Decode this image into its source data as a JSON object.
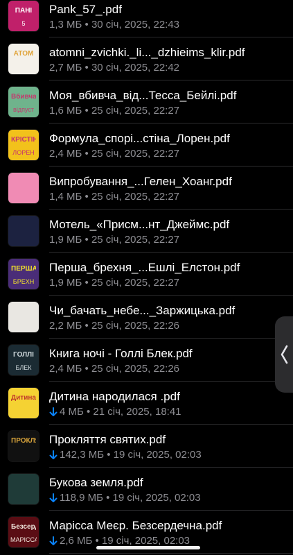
{
  "files": [
    {
      "title": "Pank_57_.pdf",
      "meta": "1,3 МБ • 30 січ, 2025, 22:43",
      "downloading": false,
      "thumb": {
        "bg": "#c0206a",
        "fg": "#fff",
        "t1": "ПАНІ",
        "t2": "5"
      }
    },
    {
      "title": "atomni_zvichki._li..._dzhieims_klir.pdf",
      "meta": "2,7 МБ • 30 січ, 2025, 22:42",
      "downloading": false,
      "thumb": {
        "bg": "#f4f1ea",
        "fg": "#e0a43a",
        "t1": "АТОМ",
        "t2": ""
      }
    },
    {
      "title": "Моя_вбивча_від...Тесса_Бейлі.pdf",
      "meta": "1,6 МБ • 25 січ, 2025, 22:27",
      "downloading": false,
      "thumb": {
        "bg": "#6fb38c",
        "fg": "#c23a6e",
        "t1": "Вбивча",
        "t2": "відпуст"
      }
    },
    {
      "title": "Формула_спорі...стіна_Лорен.pdf",
      "meta": "2,4 МБ • 25 січ, 2025, 22:27",
      "downloading": false,
      "thumb": {
        "bg": "#f2c21b",
        "fg": "#c8356c",
        "t1": "КРІСТІН",
        "t2": "ЛОРЕН"
      }
    },
    {
      "title": "Випробування_...Гелен_Хоанг.pdf",
      "meta": "1,4 МБ • 25 січ, 2025, 22:27",
      "downloading": false,
      "thumb": {
        "bg": "#f08bb4",
        "fg": "#fff",
        "t1": "",
        "t2": ""
      }
    },
    {
      "title": "Мотель_«Присм...нт_Джеймс.pdf",
      "meta": "1,9 МБ • 25 січ, 2025, 22:27",
      "downloading": false,
      "thumb": {
        "bg": "#1c2240",
        "fg": "#f2b64c",
        "t1": "",
        "t2": ""
      }
    },
    {
      "title": "Перша_брехня_...Ешлі_Елстон.pdf",
      "meta": "1,9 МБ • 25 січ, 2025, 22:27",
      "downloading": false,
      "thumb": {
        "bg": "#4a2d78",
        "fg": "#f2e22c",
        "t1": "ПЕРША",
        "t2": "БРЕХН"
      }
    },
    {
      "title": "Чи_бачать_небе..._Заржицька.pdf",
      "meta": "2,2 МБ • 25 січ, 2025, 22:26",
      "downloading": false,
      "thumb": {
        "bg": "#e9e7e2",
        "fg": "#222",
        "t1": "",
        "t2": ""
      }
    },
    {
      "title": "Книга ночі - Голлі Блек.pdf",
      "meta": "2,4 МБ • 25 січ, 2025, 22:26",
      "downloading": false,
      "thumb": {
        "bg": "#1b2b33",
        "fg": "#cfd8dc",
        "t1": "ГОЛЛІ",
        "t2": "БЛЕК"
      }
    },
    {
      "title": "Дитина народилася .pdf",
      "meta": "4 МБ • 21 січ, 2025, 18:41",
      "downloading": true,
      "thumb": {
        "bg": "#f5d233",
        "fg": "#c0392b",
        "t1": "Дитина",
        "t2": ""
      }
    },
    {
      "title": "Прокляття святих.pdf",
      "meta": "142,3 МБ • 19 січ, 2025, 02:03",
      "downloading": true,
      "thumb": {
        "bg": "#111",
        "fg": "#d7a33b",
        "t1": "ПРОКЛЯТ",
        "t2": ""
      }
    },
    {
      "title": "Букова земля.pdf",
      "meta": "118,9 МБ • 19 січ, 2025, 02:03",
      "downloading": true,
      "thumb": {
        "bg": "#1f3b38",
        "fg": "#e8e2d0",
        "t1": "",
        "t2": ""
      }
    },
    {
      "title": "Марісса Меєр. Безсердечна.pdf",
      "meta": "2,6 МБ • 19 січ, 2025, 02:03",
      "downloading": true,
      "thumb": {
        "bg": "#5a0d14",
        "fg": "#f0e6dc",
        "t1": "Безсердеч",
        "t2": "МАРІССА"
      }
    }
  ],
  "colors": {
    "background": "#000000",
    "secondary_text": "#8e8e93",
    "accent_blue": "#0a84ff",
    "separator": "#2c2c2e"
  },
  "icons": {
    "download": "arrow-down-icon",
    "collapse_handle": "chevron-left-icon"
  }
}
